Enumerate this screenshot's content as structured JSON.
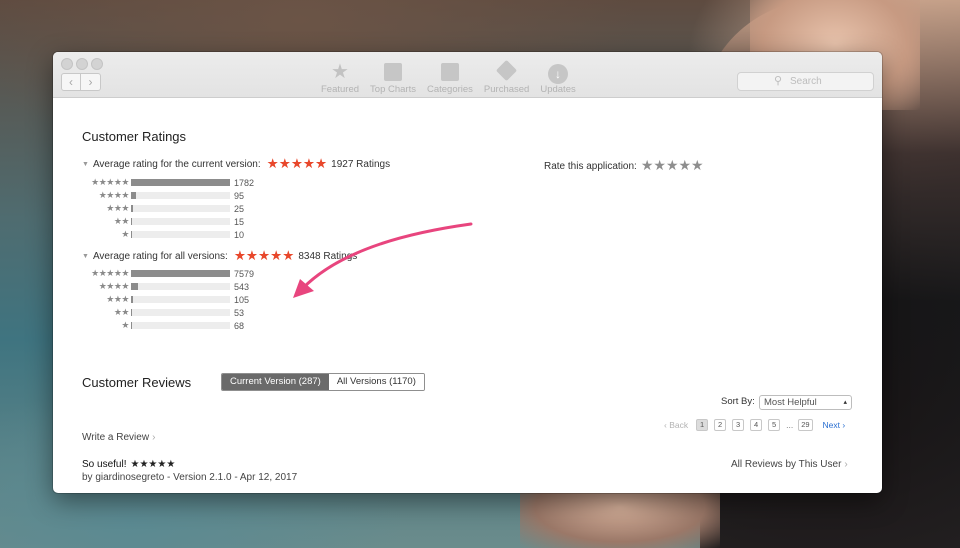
{
  "toolbar": {
    "back_icon": "chevron-left-icon",
    "forward_icon": "chevron-right-icon",
    "tabs": [
      {
        "label": "Featured",
        "icon": "star-icon"
      },
      {
        "label": "Top Charts",
        "icon": "list-icon"
      },
      {
        "label": "Categories",
        "icon": "box-icon"
      },
      {
        "label": "Purchased",
        "icon": "tag-icon"
      },
      {
        "label": "Updates",
        "icon": "download-icon"
      }
    ],
    "search_placeholder": "Search"
  },
  "ratings": {
    "title": "Customer Ratings",
    "current": {
      "label": "Average rating for the current version:",
      "stars": "★★★★★",
      "count_text": "1927 Ratings",
      "histogram": [
        {
          "stars": "★★★★★",
          "count": "1782",
          "fraction": 1.0
        },
        {
          "stars": "★★★★",
          "count": "95",
          "fraction": 0.053
        },
        {
          "stars": "★★★",
          "count": "25",
          "fraction": 0.014
        },
        {
          "stars": "★★",
          "count": "15",
          "fraction": 0.0
        },
        {
          "stars": "★",
          "count": "10",
          "fraction": 0.0
        }
      ]
    },
    "all": {
      "label": "Average rating for all versions:",
      "stars": "★★★★★",
      "count_text": "8348 Ratings",
      "histogram": [
        {
          "stars": "★★★★★",
          "count": "7579",
          "fraction": 1.0
        },
        {
          "stars": "★★★★",
          "count": "543",
          "fraction": 0.072
        },
        {
          "stars": "★★★",
          "count": "105",
          "fraction": 0.014
        },
        {
          "stars": "★★",
          "count": "53",
          "fraction": 0.0
        },
        {
          "stars": "★",
          "count": "68",
          "fraction": 0.0
        }
      ]
    },
    "rate_label": "Rate this application:",
    "rate_stars": "★★★★★"
  },
  "reviews": {
    "title": "Customer Reviews",
    "tabs": [
      "Current Version (287)",
      "All Versions (1170)"
    ],
    "active_tab": 0,
    "sort_label": "Sort By:",
    "sort_value": "Most Helpful",
    "pager": {
      "back": "‹ Back",
      "pages": [
        "1",
        "2",
        "3",
        "4",
        "5"
      ],
      "current": "1",
      "ellipsis": "...",
      "last": "29",
      "next": "Next ›"
    },
    "write_review": "Write a Review",
    "items": [
      {
        "title": "So useful!",
        "stars": "★★★★★",
        "meta": "by giardinosegreto - Version 2.1.0 - Apr 12, 2017"
      }
    ],
    "all_by_user": "All Reviews by This User"
  },
  "colors": {
    "star_orange": "#e8472b",
    "annotation_pink": "#e8457e",
    "bar_fill": "#8c8c8c",
    "accent_blue": "#2a6fd1"
  }
}
